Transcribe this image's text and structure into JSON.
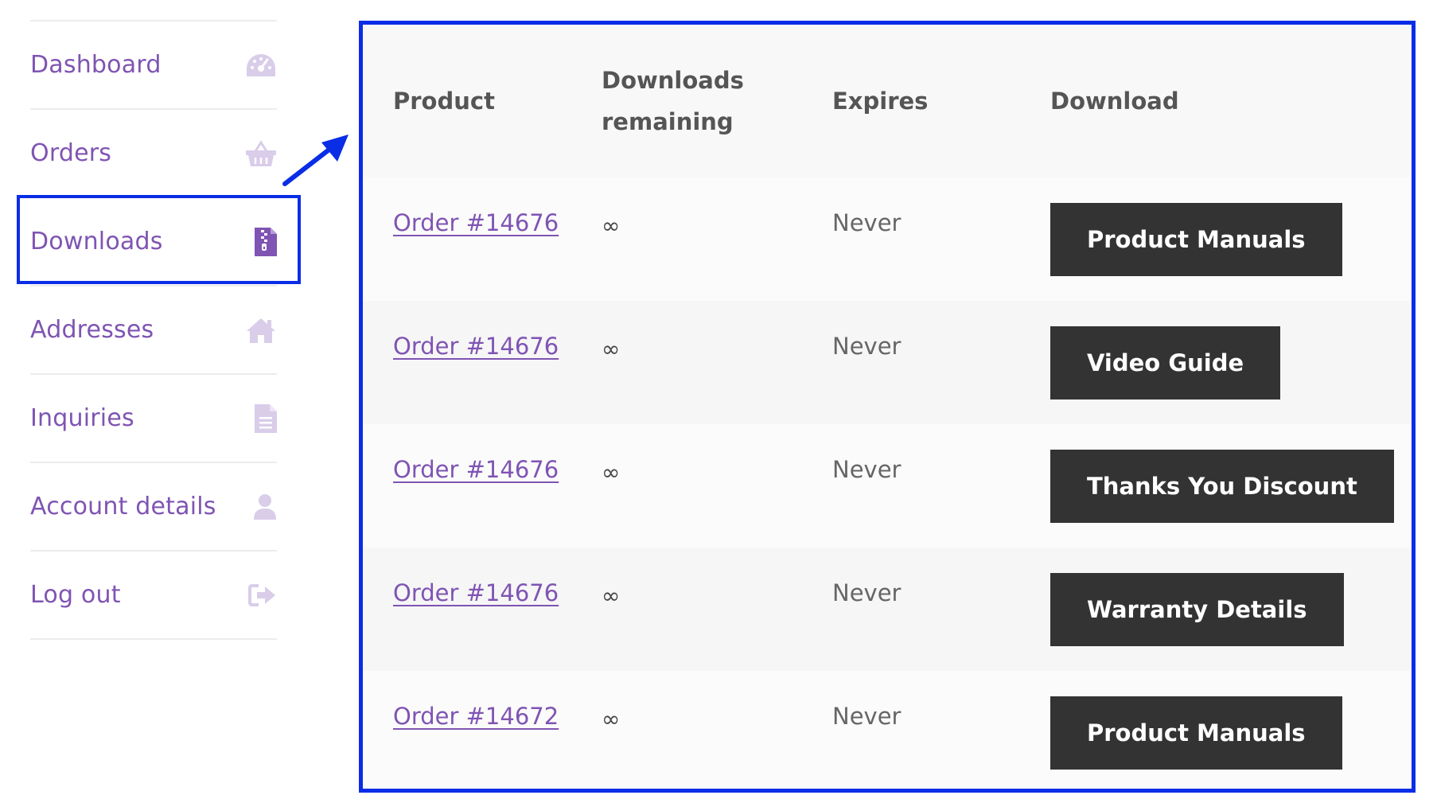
{
  "sidebar": {
    "items": [
      {
        "label": "Dashboard",
        "icon": "dashboard-gauge-icon"
      },
      {
        "label": "Orders",
        "icon": "basket-icon"
      },
      {
        "label": "Downloads",
        "icon": "file-archive-icon",
        "active": true
      },
      {
        "label": "Addresses",
        "icon": "home-icon"
      },
      {
        "label": "Inquiries",
        "icon": "document-icon"
      },
      {
        "label": "Account details",
        "icon": "user-icon"
      },
      {
        "label": "Log out",
        "icon": "sign-out-icon"
      }
    ]
  },
  "downloads_table": {
    "headers": {
      "product": "Product",
      "remaining_line1": "Downloads",
      "remaining_line2": "remaining",
      "expires": "Expires",
      "download": "Download"
    },
    "rows": [
      {
        "product": "Order #14676",
        "remaining": "∞",
        "expires": "Never",
        "download": "Product Manuals"
      },
      {
        "product": "Order #14676",
        "remaining": "∞",
        "expires": "Never",
        "download": "Video Guide"
      },
      {
        "product": "Order #14676",
        "remaining": "∞",
        "expires": "Never",
        "download": "Thanks You Discount"
      },
      {
        "product": "Order #14676",
        "remaining": "∞",
        "expires": "Never",
        "download": "Warranty Details"
      },
      {
        "product": "Order #14672",
        "remaining": "∞",
        "expires": "Never",
        "download": "Product Manuals"
      }
    ]
  },
  "colors": {
    "link": "#7f54b3",
    "icon_muted": "#d9cdea",
    "icon_active": "#7f54b3",
    "highlight": "#0a2de6",
    "button_bg": "#333333",
    "button_text": "#ffffff"
  }
}
